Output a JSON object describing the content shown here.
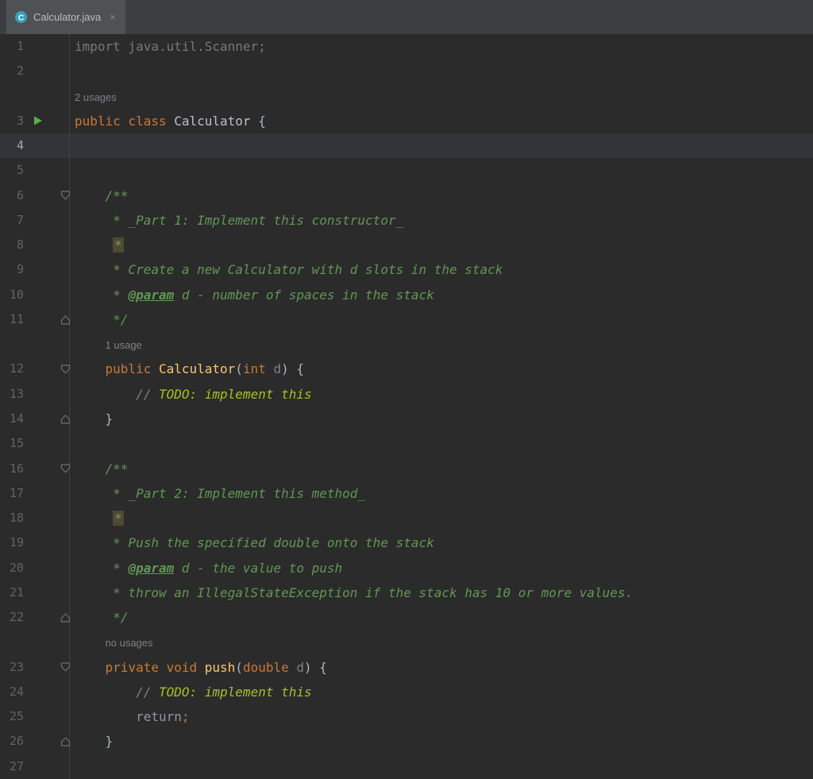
{
  "tab": {
    "label": "Calculator.java",
    "close_glyph": "×"
  },
  "colors": {
    "editor_background": "#2b2b2b",
    "tab_bar_background": "#3c3f41",
    "active_tab_background": "#4e5254",
    "caret_row_background": "#313539",
    "line_number": "#606366",
    "keyword": "#cc7832",
    "comment": "#629755",
    "todo": "#a8c023",
    "method_declaration": "#ffc66d",
    "plain_text": "#a9b7c6",
    "unused_gray": "#787878",
    "run_icon_green": "#55b04f",
    "star_highlight_background": "#4e4a33"
  },
  "editor": {
    "inlay_hints": [
      "2 usages",
      "1 usage",
      "no usages"
    ],
    "rows": [
      {
        "kind": "code",
        "num": "1",
        "tokens": [
          [
            "import java.util.Scanner;",
            "gray"
          ]
        ]
      },
      {
        "kind": "code",
        "num": "2",
        "tokens": []
      },
      {
        "kind": "inlay",
        "text": "2 usages",
        "indent_ch": 0
      },
      {
        "kind": "code",
        "num": "3",
        "gutter": "run",
        "tokens": [
          [
            "public class ",
            "kw"
          ],
          [
            "Calculator ",
            "cls"
          ],
          [
            "{",
            "plain"
          ]
        ]
      },
      {
        "kind": "code",
        "num": "4",
        "caret": true,
        "tokens": []
      },
      {
        "kind": "code",
        "num": "5",
        "tokens": []
      },
      {
        "kind": "code",
        "num": "6",
        "gutter": "fold-down",
        "tokens": [
          [
            "    ",
            "plain"
          ],
          [
            "/**",
            "comment"
          ]
        ]
      },
      {
        "kind": "code",
        "num": "7",
        "tokens": [
          [
            "     * _Part 1: Implement this constructor_",
            "comment"
          ]
        ]
      },
      {
        "kind": "code",
        "num": "8",
        "tokens": [
          [
            "     ",
            "plain"
          ],
          [
            "*",
            "star"
          ]
        ]
      },
      {
        "kind": "code",
        "num": "9",
        "tokens": [
          [
            "     * Create a new Calculator with d slots in the stack",
            "comment"
          ]
        ]
      },
      {
        "kind": "code",
        "num": "10",
        "tokens": [
          [
            "     * ",
            "comment"
          ],
          [
            "@param",
            "doctag"
          ],
          [
            " d - number of spaces in the stack",
            "comment"
          ]
        ]
      },
      {
        "kind": "code",
        "num": "11",
        "gutter": "fold-up",
        "tokens": [
          [
            "     */",
            "comment"
          ]
        ]
      },
      {
        "kind": "inlay",
        "text": "1 usage",
        "indent_ch": 4
      },
      {
        "kind": "code",
        "num": "12",
        "gutter": "fold-down",
        "tokens": [
          [
            "    ",
            "plain"
          ],
          [
            "public ",
            "kw"
          ],
          [
            "Calculator",
            "method"
          ],
          [
            "(",
            "plain"
          ],
          [
            "int ",
            "kw"
          ],
          [
            "d",
            "param"
          ],
          [
            ") {",
            "plain"
          ]
        ]
      },
      {
        "kind": "code",
        "num": "13",
        "tokens": [
          [
            "        ",
            "plain"
          ],
          [
            "// ",
            "linecomment"
          ],
          [
            "TODO: implement this",
            "todo"
          ]
        ]
      },
      {
        "kind": "code",
        "num": "14",
        "gutter": "fold-up",
        "tokens": [
          [
            "    }",
            "plain"
          ]
        ]
      },
      {
        "kind": "code",
        "num": "15",
        "tokens": []
      },
      {
        "kind": "code",
        "num": "16",
        "gutter": "fold-down",
        "tokens": [
          [
            "    ",
            "plain"
          ],
          [
            "/**",
            "comment"
          ]
        ]
      },
      {
        "kind": "code",
        "num": "17",
        "tokens": [
          [
            "     * _Part 2: Implement this method_",
            "comment"
          ]
        ]
      },
      {
        "kind": "code",
        "num": "18",
        "tokens": [
          [
            "     ",
            "plain"
          ],
          [
            "*",
            "star"
          ]
        ]
      },
      {
        "kind": "code",
        "num": "19",
        "tokens": [
          [
            "     * Push the specified double onto the stack",
            "comment"
          ]
        ]
      },
      {
        "kind": "code",
        "num": "20",
        "tokens": [
          [
            "     * ",
            "comment"
          ],
          [
            "@param",
            "doctag"
          ],
          [
            " d - the value to push",
            "comment"
          ]
        ]
      },
      {
        "kind": "code",
        "num": "21",
        "tokens": [
          [
            "     * throw an IllegalStateException if the stack has 10 or more values.",
            "comment"
          ]
        ]
      },
      {
        "kind": "code",
        "num": "22",
        "gutter": "fold-up",
        "tokens": [
          [
            "     */",
            "comment"
          ]
        ]
      },
      {
        "kind": "inlay",
        "text": "no usages",
        "indent_ch": 4
      },
      {
        "kind": "code",
        "num": "23",
        "gutter": "fold-down",
        "tokens": [
          [
            "    ",
            "plain"
          ],
          [
            "private void ",
            "kw"
          ],
          [
            "push",
            "method"
          ],
          [
            "(",
            "plain"
          ],
          [
            "double ",
            "kw"
          ],
          [
            "d",
            "param"
          ],
          [
            ") {",
            "plain"
          ]
        ]
      },
      {
        "kind": "code",
        "num": "24",
        "tokens": [
          [
            "        ",
            "plain"
          ],
          [
            "// ",
            "linecomment"
          ],
          [
            "TODO: implement this",
            "todo"
          ]
        ]
      },
      {
        "kind": "code",
        "num": "25",
        "tokens": [
          [
            "        ",
            "plain"
          ],
          [
            "return",
            "ret"
          ],
          [
            ";",
            "kw"
          ]
        ]
      },
      {
        "kind": "code",
        "num": "26",
        "gutter": "fold-up",
        "tokens": [
          [
            "    }",
            "plain"
          ]
        ]
      },
      {
        "kind": "code",
        "num": "27",
        "tokens": []
      }
    ]
  }
}
